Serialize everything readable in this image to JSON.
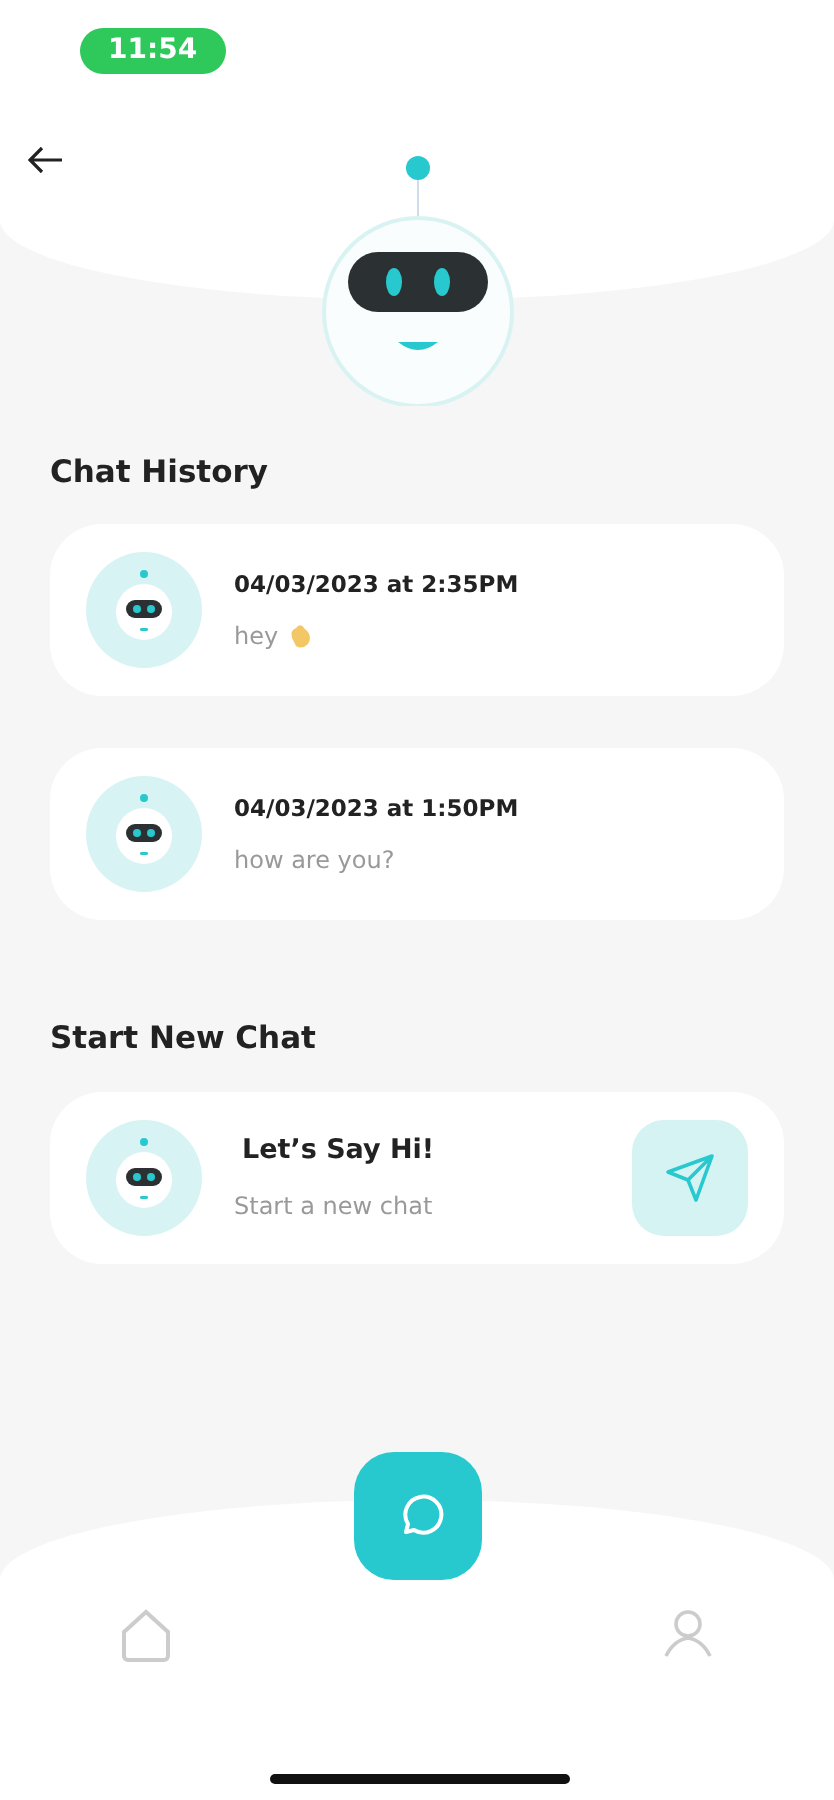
{
  "status_bar": {
    "time": "11:54"
  },
  "chat_history": {
    "title": "Chat History",
    "chats": [
      {
        "date": "04/03/2023 at 2:35PM",
        "message": "hey",
        "wave": true
      },
      {
        "date": "04/03/2023 at 1:50PM",
        "message": "how are you?",
        "wave": false
      }
    ]
  },
  "new_chat": {
    "title": "Start New Chat",
    "card": {
      "title": "Let’s Say Hi!",
      "subtitle": "Start a new chat"
    }
  }
}
